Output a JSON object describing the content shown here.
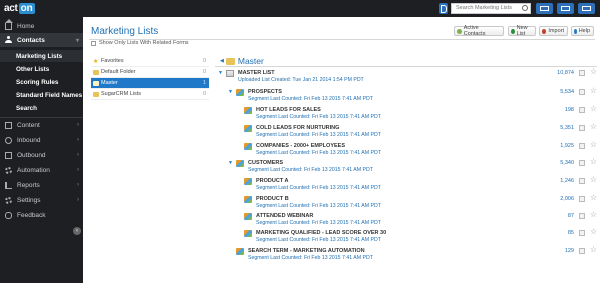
{
  "app": {
    "logo_act": "act",
    "logo_on": "on",
    "search_placeholder": "Search Marketing Lists"
  },
  "sidebar": {
    "items": [
      {
        "label": "Home",
        "icon": "home-icon"
      },
      {
        "label": "Contacts",
        "icon": "contacts-icon",
        "active": true
      },
      {
        "label": "Content",
        "icon": "content-icon"
      },
      {
        "label": "Inbound",
        "icon": "inbound-icon"
      },
      {
        "label": "Outbound",
        "icon": "outbound-icon"
      },
      {
        "label": "Automation",
        "icon": "automation-icon"
      },
      {
        "label": "Reports",
        "icon": "reports-icon"
      },
      {
        "label": "Settings",
        "icon": "settings-icon"
      },
      {
        "label": "Feedback",
        "icon": "feedback-icon"
      }
    ],
    "subitems": [
      {
        "label": "Marketing Lists",
        "active": true
      },
      {
        "label": "Other Lists"
      },
      {
        "label": "Scoring Rules"
      },
      {
        "label": "Standard Field Names"
      },
      {
        "label": "Search"
      }
    ]
  },
  "header": {
    "title": "Marketing Lists",
    "show_only_label": "Show Only Lists With Related Forms",
    "buttons": {
      "active_contacts": "Active Contacts",
      "new_list": "New List",
      "import": "Import",
      "help": "Help"
    }
  },
  "folders": [
    {
      "label": "Favorites",
      "count": "0",
      "icon": "star-icon"
    },
    {
      "label": "Default Folder",
      "count": "0",
      "icon": "folder-icon"
    },
    {
      "label": "Master",
      "count": "1",
      "icon": "folder-icon",
      "selected": true
    },
    {
      "label": "SugarCRM Lists",
      "count": "0",
      "icon": "folder-icon"
    }
  ],
  "tree": {
    "folder_title": "Master",
    "rows": [
      {
        "name": "MASTER LIST",
        "sub": "Uploaded List Created:  Tue Jan 21 2014 1:54 PM PDT",
        "count": "10,874",
        "type": "sheet",
        "toggle": true
      },
      {
        "name": "PROSPECTS",
        "sub": "Segment Last Counted:  Fri Feb 13 2015 7:41 AM PDT",
        "count": "5,534",
        "type": "segment",
        "toggle": true
      },
      {
        "name": "HOT LEADS FOR SALES",
        "sub": "Segment Last Counted:  Fri Feb 13 2015 7:41 AM PDT",
        "count": "198",
        "type": "segment",
        "toggle": false
      },
      {
        "name": "COLD LEADS FOR NURTURING",
        "sub": "Segment Last Counted:  Fri Feb 13 2015 7:41 AM PDT",
        "count": "5,351",
        "type": "segment",
        "toggle": false
      },
      {
        "name": "COMPANIES - 2000+ EMPLOYEES",
        "sub": "Segment Last Counted:  Fri Feb 13 2015 7:41 AM PDT",
        "count": "1,925",
        "type": "segment",
        "toggle": false
      },
      {
        "name": "CUSTOMERS",
        "sub": "Segment Last Counted:  Fri Feb 13 2015 7:41 AM PDT",
        "count": "5,340",
        "type": "segment",
        "toggle": true
      },
      {
        "name": "PRODUCT A",
        "sub": "Segment Last Counted:  Fri Feb 13 2015 7:41 AM PDT",
        "count": "1,246",
        "type": "segment",
        "toggle": false
      },
      {
        "name": "PRODUCT B",
        "sub": "Segment Last Counted:  Fri Feb 13 2015 7:41 AM PDT",
        "count": "2,006",
        "type": "segment",
        "toggle": false
      },
      {
        "name": "ATTENDED WEBINAR",
        "sub": "Segment Last Counted:  Fri Feb 13 2015 7:41 AM PDT",
        "count": "87",
        "type": "segment",
        "toggle": false
      },
      {
        "name": "MARKETING QUALIFIED - LEAD SCORE OVER 30",
        "sub": "Segment Last Counted:  Fri Feb 13 2015 7:41 AM PDT",
        "count": "85",
        "type": "segment",
        "toggle": false
      },
      {
        "name": "SEARCH TERM - MARKETING AUTOMATION",
        "sub": "Segment Last Counted:  Fri Feb 13 2015 7:41 AM PDT",
        "count": "129",
        "type": "segment",
        "toggle": false
      }
    ]
  },
  "colors": {
    "sidebar_bg": "#1e1f22",
    "accent_blue": "#1f78c8",
    "title_blue": "#1f6fb2"
  }
}
